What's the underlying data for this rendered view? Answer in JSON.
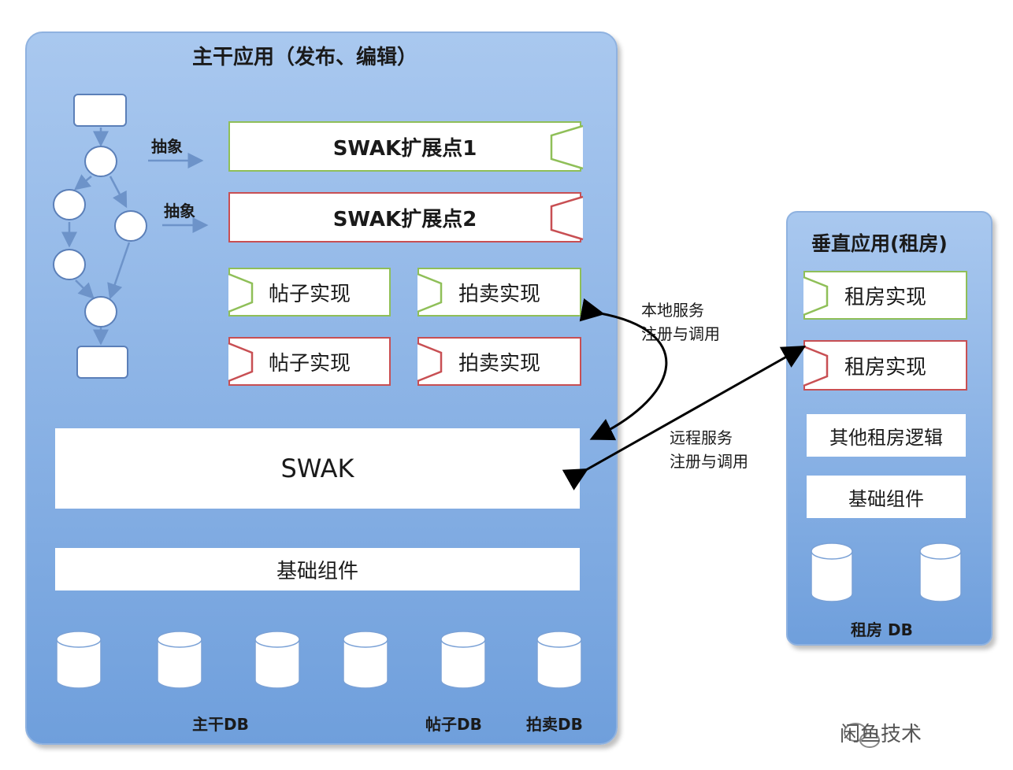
{
  "main_app": {
    "title": "主干应用（发布、编辑）",
    "abstract_label_1": "抽象",
    "abstract_label_2": "抽象",
    "extension_1": "SWAK扩展点1",
    "extension_2": "SWAK扩展点2",
    "impl_posts_green": "帖子实现",
    "impl_auction_green": "拍卖实现",
    "impl_posts_red": "帖子实现",
    "impl_auction_red": "拍卖实现",
    "swak": "SWAK",
    "base_components": "基础组件",
    "db_main": "主干DB",
    "db_posts": "帖子DB",
    "db_auction": "拍卖DB"
  },
  "vertical_app": {
    "title": "垂直应用(租房)",
    "impl_rent_green": "租房实现",
    "impl_rent_red": "租房实现",
    "other_logic": "其他租房逻辑",
    "base_components": "基础组件",
    "db_rent": "租房 DB"
  },
  "connections": {
    "local_service": "本地服务\n注册与调用",
    "local_service_line1": "本地服务",
    "local_service_line2": "注册与调用",
    "remote_service_line1": "远程服务",
    "remote_service_line2": "注册与调用"
  },
  "watermark": "闲鱼技术",
  "colors": {
    "panel_top": "#a9c8ef",
    "panel_bottom": "#6f9fdc",
    "green_border": "#8fbf58",
    "red_border": "#c84f53",
    "flow_arrow": "#6d93c9"
  }
}
